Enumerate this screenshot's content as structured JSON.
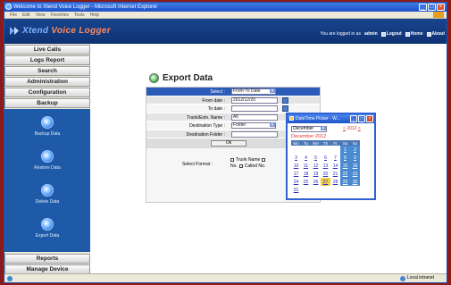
{
  "window": {
    "title": "Welcome to Xtend Voice Logger - Microsoft Internet Explorer"
  },
  "menubar": {
    "items": [
      "File",
      "Edit",
      "View",
      "Favorites",
      "Tools",
      "Help"
    ]
  },
  "header": {
    "logo_x": "Xtend",
    "logo_vl": "Voice Logger",
    "logged_in_text": "You are logged in as",
    "user": "admin",
    "logout": "Logout",
    "home": "Home",
    "about": "About"
  },
  "sidebar": {
    "live_calls": "Live Calls",
    "logs_report": "Logs Report",
    "search": "Search",
    "administration": "Administration",
    "configuration": "Configuration",
    "backup": "Backup",
    "backup_items": [
      "Backup Data",
      "Restore Data",
      "Delete Data",
      "Export Data"
    ],
    "reports": "Reports",
    "manage_device": "Manage Device"
  },
  "export": {
    "title": "Export Data",
    "select_label": "Select :",
    "select_value": "From-To Date",
    "from_label": "From date :",
    "from_value": "2012/12/20",
    "to_label": "To date :",
    "to_value": "",
    "trunk_label": "Trunk/Extn. Name :",
    "trunk_value": "All",
    "dest_type_label": "Destination Type :",
    "dest_type_value": "Folder",
    "dest_folder_label": "Destination Folder :",
    "dest_folder_value": "",
    "ok_label": "Ok",
    "format_label": "Select Format :",
    "format_opt1": "Trunk Name",
    "format_opt2": "Called No.",
    "format_no": "No."
  },
  "picker": {
    "title": "DateTime Picker - W...",
    "month": "December",
    "year_prev": "<",
    "year": "2012",
    "year_next": ">",
    "caption": "December 2012",
    "weekdays": [
      "Mo",
      "Tu",
      "We",
      "Th",
      "Fr",
      "Sa",
      "Su"
    ],
    "weeks": [
      [
        "",
        "",
        "",
        "",
        "",
        "1",
        "2"
      ],
      [
        "3",
        "4",
        "5",
        "6",
        "7",
        "8",
        "9"
      ],
      [
        "10",
        "11",
        "12",
        "13",
        "14",
        "15",
        "16"
      ],
      [
        "17",
        "18",
        "19",
        "20",
        "21",
        "22",
        "23"
      ],
      [
        "24",
        "25",
        "26",
        "27",
        "28",
        "29",
        "30"
      ],
      [
        "31",
        "",
        "",
        "",
        "",
        "",
        ""
      ]
    ],
    "today": "27"
  },
  "statusbar": {
    "zone": "Local intranet"
  }
}
